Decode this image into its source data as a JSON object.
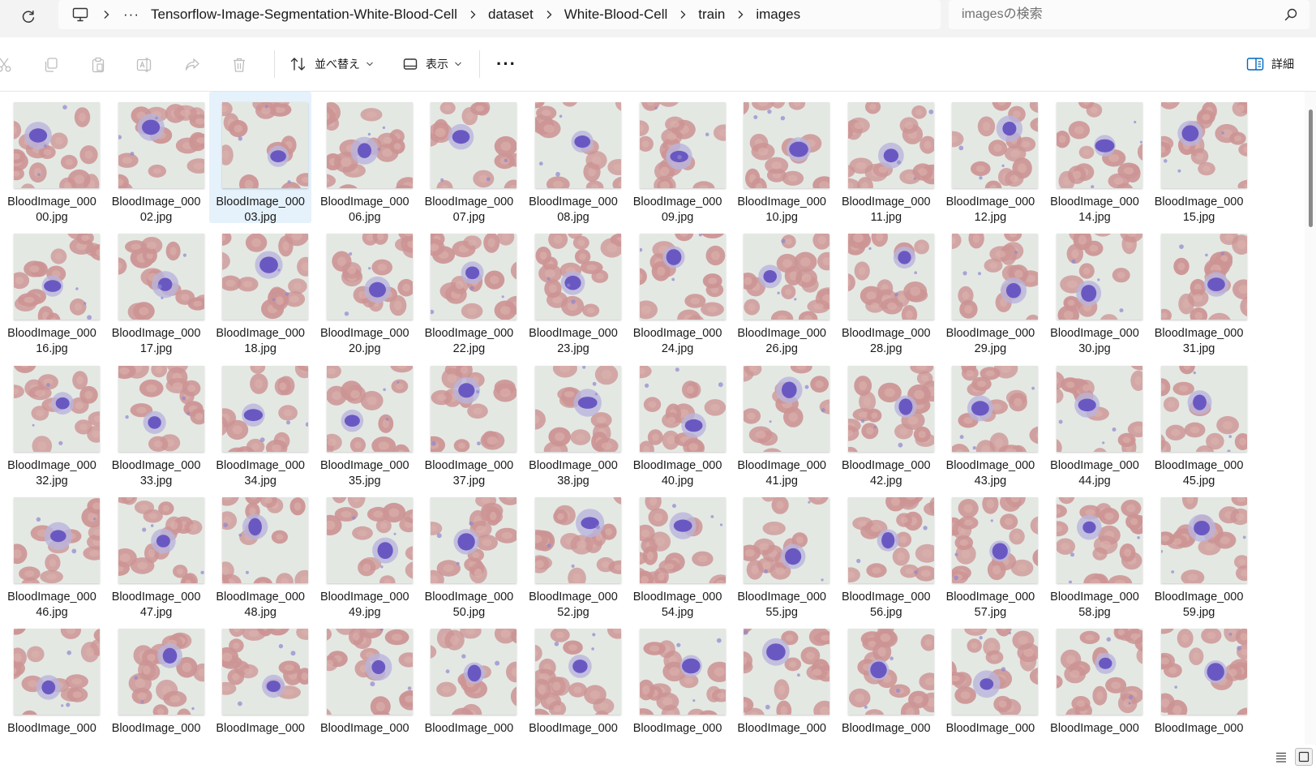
{
  "breadcrumb": {
    "more": "···",
    "items": [
      "Tensorflow-Image-Segmentation-White-Blood-Cell",
      "dataset",
      "White-Blood-Cell",
      "train",
      "images"
    ]
  },
  "search": {
    "placeholder": "imagesの検索"
  },
  "toolbar": {
    "sort_label": "並べ替え",
    "view_label": "表示",
    "more_label": "···",
    "details_label": "詳細"
  },
  "files": [
    {
      "line1": "BloodImage_000",
      "line2": "00.jpg"
    },
    {
      "line1": "BloodImage_000",
      "line2": "02.jpg"
    },
    {
      "line1": "BloodImage_000",
      "line2": "03.jpg",
      "selected": true
    },
    {
      "line1": "BloodImage_000",
      "line2": "06.jpg"
    },
    {
      "line1": "BloodImage_000",
      "line2": "07.jpg"
    },
    {
      "line1": "BloodImage_000",
      "line2": "08.jpg"
    },
    {
      "line1": "BloodImage_000",
      "line2": "09.jpg"
    },
    {
      "line1": "BloodImage_000",
      "line2": "10.jpg"
    },
    {
      "line1": "BloodImage_000",
      "line2": "11.jpg"
    },
    {
      "line1": "BloodImage_000",
      "line2": "12.jpg"
    },
    {
      "line1": "BloodImage_000",
      "line2": "14.jpg"
    },
    {
      "line1": "BloodImage_000",
      "line2": "15.jpg"
    },
    {
      "line1": "BloodImage_000",
      "line2": "16.jpg"
    },
    {
      "line1": "BloodImage_000",
      "line2": "17.jpg"
    },
    {
      "line1": "BloodImage_000",
      "line2": "18.jpg"
    },
    {
      "line1": "BloodImage_000",
      "line2": "20.jpg"
    },
    {
      "line1": "BloodImage_000",
      "line2": "22.jpg"
    },
    {
      "line1": "BloodImage_000",
      "line2": "23.jpg"
    },
    {
      "line1": "BloodImage_000",
      "line2": "24.jpg"
    },
    {
      "line1": "BloodImage_000",
      "line2": "26.jpg"
    },
    {
      "line1": "BloodImage_000",
      "line2": "28.jpg"
    },
    {
      "line1": "BloodImage_000",
      "line2": "29.jpg"
    },
    {
      "line1": "BloodImage_000",
      "line2": "30.jpg"
    },
    {
      "line1": "BloodImage_000",
      "line2": "31.jpg"
    },
    {
      "line1": "BloodImage_000",
      "line2": "32.jpg"
    },
    {
      "line1": "BloodImage_000",
      "line2": "33.jpg"
    },
    {
      "line1": "BloodImage_000",
      "line2": "34.jpg"
    },
    {
      "line1": "BloodImage_000",
      "line2": "35.jpg"
    },
    {
      "line1": "BloodImage_000",
      "line2": "37.jpg"
    },
    {
      "line1": "BloodImage_000",
      "line2": "38.jpg"
    },
    {
      "line1": "BloodImage_000",
      "line2": "40.jpg"
    },
    {
      "line1": "BloodImage_000",
      "line2": "41.jpg"
    },
    {
      "line1": "BloodImage_000",
      "line2": "42.jpg"
    },
    {
      "line1": "BloodImage_000",
      "line2": "43.jpg"
    },
    {
      "line1": "BloodImage_000",
      "line2": "44.jpg"
    },
    {
      "line1": "BloodImage_000",
      "line2": "45.jpg"
    },
    {
      "line1": "BloodImage_000",
      "line2": "46.jpg"
    },
    {
      "line1": "BloodImage_000",
      "line2": "47.jpg"
    },
    {
      "line1": "BloodImage_000",
      "line2": "48.jpg"
    },
    {
      "line1": "BloodImage_000",
      "line2": "49.jpg"
    },
    {
      "line1": "BloodImage_000",
      "line2": "50.jpg"
    },
    {
      "line1": "BloodImage_000",
      "line2": "52.jpg"
    },
    {
      "line1": "BloodImage_000",
      "line2": "54.jpg"
    },
    {
      "line1": "BloodImage_000",
      "line2": "55.jpg"
    },
    {
      "line1": "BloodImage_000",
      "line2": "56.jpg"
    },
    {
      "line1": "BloodImage_000",
      "line2": "57.jpg"
    },
    {
      "line1": "BloodImage_000",
      "line2": "58.jpg"
    },
    {
      "line1": "BloodImage_000",
      "line2": "59.jpg"
    },
    {
      "line1": "BloodImage_000",
      "line2": ""
    },
    {
      "line1": "BloodImage_000",
      "line2": ""
    },
    {
      "line1": "BloodImage_000",
      "line2": ""
    },
    {
      "line1": "BloodImage_000",
      "line2": ""
    },
    {
      "line1": "BloodImage_000",
      "line2": ""
    },
    {
      "line1": "BloodImage_000",
      "line2": ""
    },
    {
      "line1": "BloodImage_000",
      "line2": ""
    },
    {
      "line1": "BloodImage_000",
      "line2": ""
    },
    {
      "line1": "BloodImage_000",
      "line2": ""
    },
    {
      "line1": "BloodImage_000",
      "line2": ""
    },
    {
      "line1": "BloodImage_000",
      "line2": ""
    },
    {
      "line1": "BloodImage_000",
      "line2": ""
    }
  ],
  "icons": {
    "refresh": "refresh-icon",
    "computer": "computer-icon",
    "chevron": "chevron-right-icon",
    "search": "search-icon",
    "cut": "scissors-icon",
    "copy": "copy-icon",
    "paste": "clipboard-icon",
    "rename": "rename-icon",
    "share": "share-icon",
    "delete": "trash-icon",
    "sort": "sort-arrows-icon",
    "view": "view-icon",
    "details": "details-pane-icon",
    "list_view": "list-view-icon",
    "grid_view": "grid-view-icon"
  },
  "colors": {
    "accent": "#0067c0",
    "selected_tile": "#e5f1fb",
    "thumb_background": "#e4e8e3",
    "red_cell": "#cc9494",
    "white_cell_nucleus": "#6a58c2"
  }
}
